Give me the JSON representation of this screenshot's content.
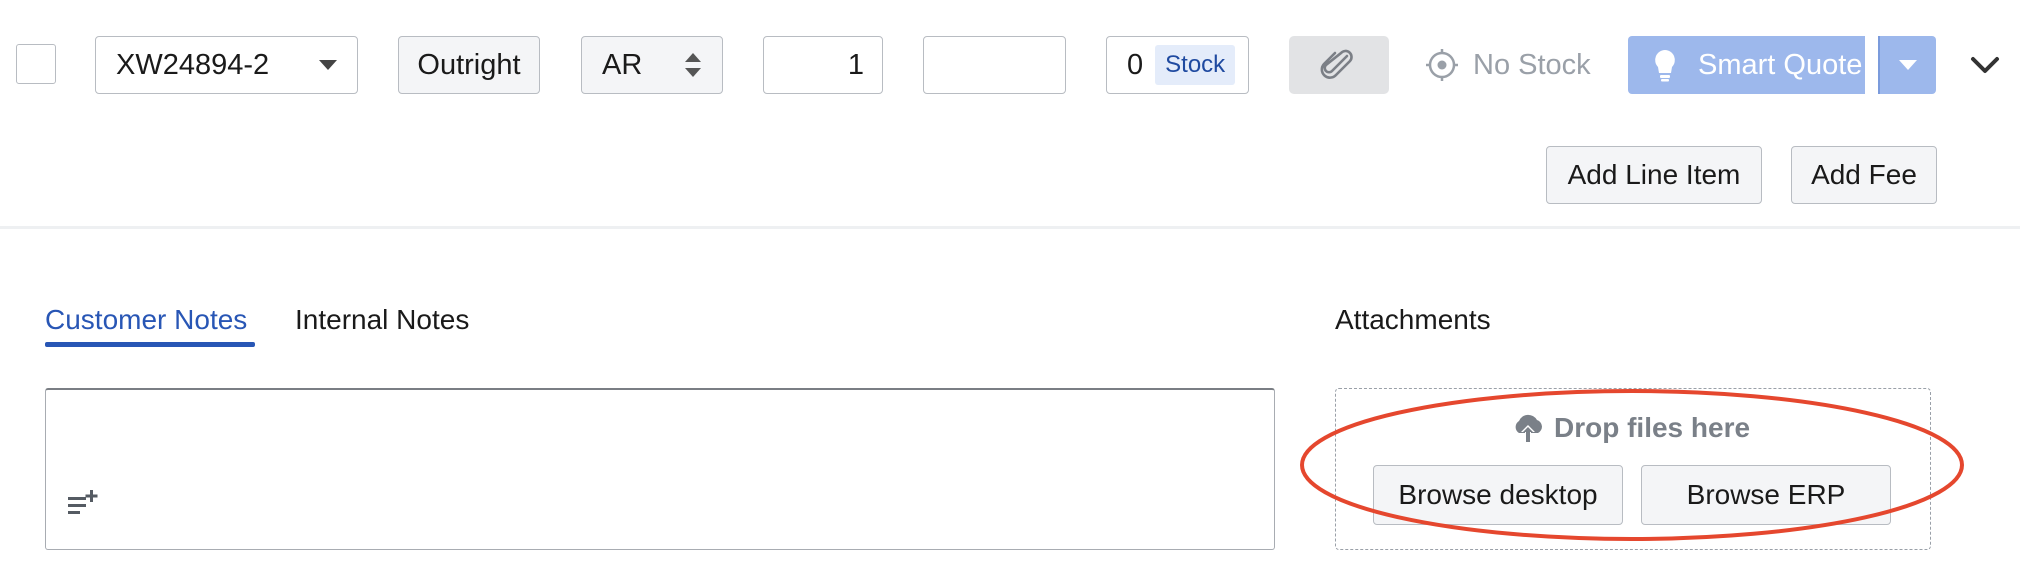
{
  "line_item": {
    "part_number": "XW24894-2",
    "condition": "Outright",
    "condition_code": "AR",
    "quantity": "1",
    "price": "",
    "stock_count": "0",
    "stock_label": "Stock",
    "no_stock_label": "No Stock",
    "smart_quote_label": "Smart Quote"
  },
  "actions": {
    "add_line_item": "Add Line Item",
    "add_fee": "Add Fee"
  },
  "notes": {
    "tabs": [
      {
        "label": "Customer Notes",
        "active": true
      },
      {
        "label": "Internal Notes",
        "active": false
      }
    ]
  },
  "attachments": {
    "heading": "Attachments",
    "drop_label": "Drop files here",
    "browse_desktop": "Browse desktop",
    "browse_erp": "Browse ERP"
  },
  "colors": {
    "accent": "#2856b5",
    "smart_quote_bg": "#9db8ec",
    "annotation_red": "#e5472e"
  },
  "icons": [
    "caret-down-icon",
    "sort-arrows-icon",
    "paperclip-icon",
    "crosshair-icon",
    "lightbulb-icon",
    "chevron-down-icon",
    "add-list-icon",
    "cloud-upload-icon"
  ]
}
